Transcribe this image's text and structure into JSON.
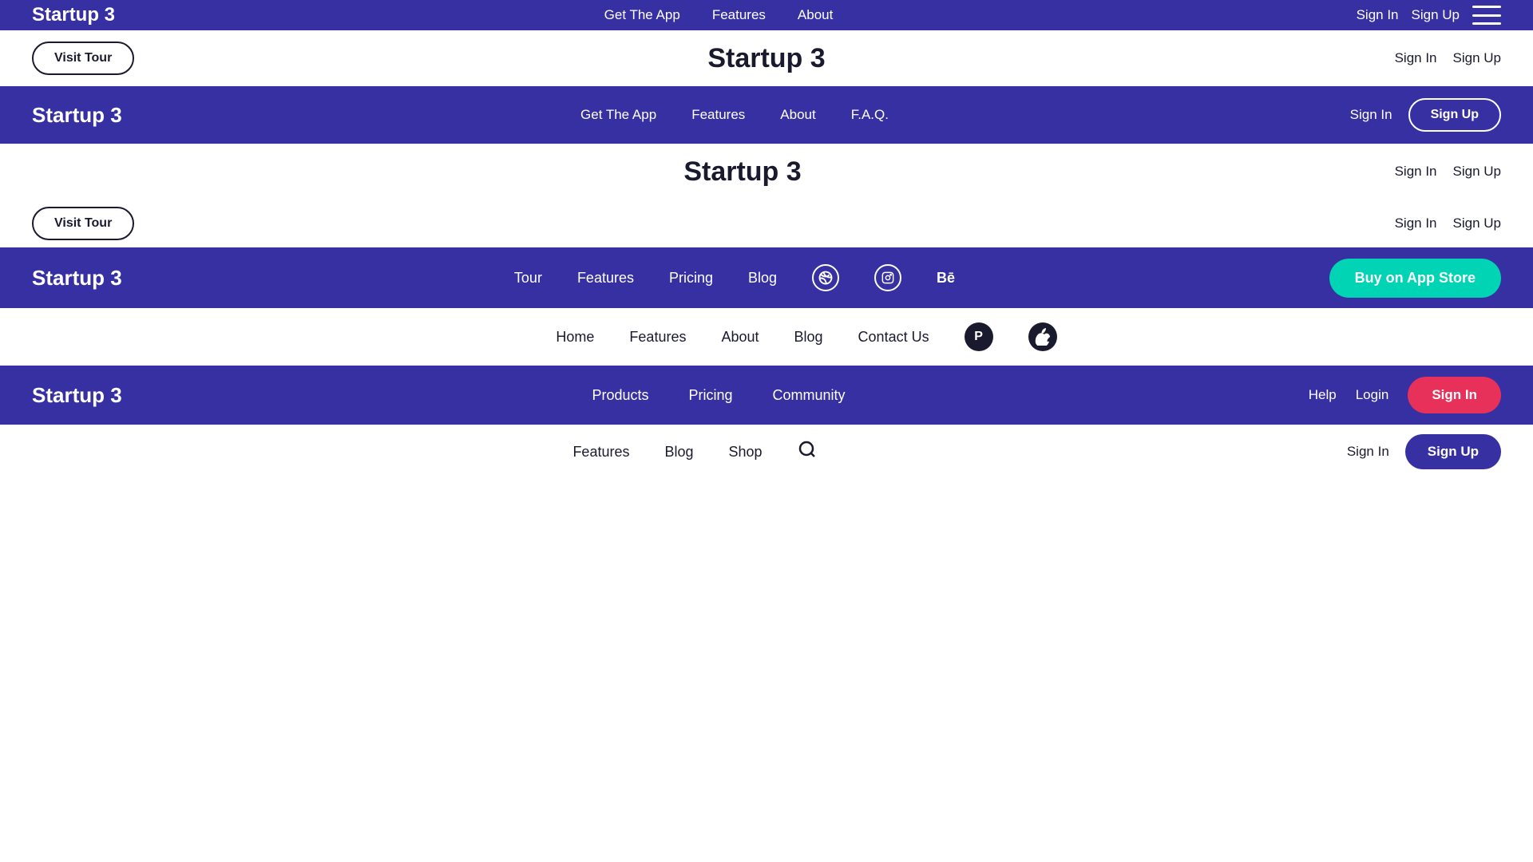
{
  "colors": {
    "purple": "#3730a3",
    "white": "#ffffff",
    "dark": "#1a1a2e",
    "teal": "#00d4b4",
    "pink": "#e8315a"
  },
  "nav1": {
    "logo": "Startup 3",
    "links": [
      "Get The App",
      "Features",
      "About",
      "F.A.Q."
    ],
    "signIn": "Sign In",
    "signUp": "Sign Up"
  },
  "band1": {
    "title": "Startup 3",
    "visitTour": "Visit Tour",
    "signIn": "Sign In",
    "signUp": "Sign Up"
  },
  "nav2": {
    "logo": "Startup 3",
    "links": [
      "Get The App",
      "Features",
      "About",
      "F.A.Q."
    ],
    "signIn": "Sign In",
    "signUp": "Sign Up"
  },
  "band2": {
    "title": "Startup 3",
    "visitTour": "Visit Tour",
    "signIn": "Sign In",
    "signUp": "Sign Up"
  },
  "nav3": {
    "logo": "Startup 3",
    "links": [
      "Tour",
      "Features",
      "Pricing",
      "Blog"
    ],
    "buyAppStore": "Buy on App Store"
  },
  "band3": {
    "home": "Home",
    "links": [
      "Features",
      "About",
      "Blog",
      "Contact Us"
    ]
  },
  "nav4": {
    "logo": "Startup 3",
    "links": [
      "Products",
      "Pricing",
      "Community"
    ],
    "help": "Help",
    "login": "Login",
    "signIn": "Sign In"
  },
  "band4": {
    "links": [
      "Features",
      "Blog",
      "Shop"
    ],
    "signIn": "Sign In",
    "signUp": "Sign Up"
  }
}
